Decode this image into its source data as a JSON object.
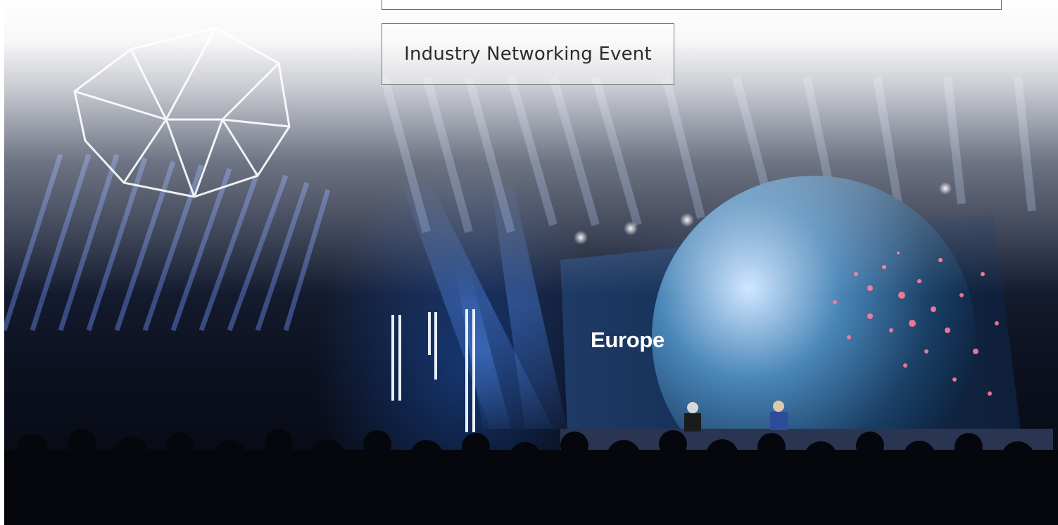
{
  "header_field": {
    "value": ""
  },
  "event_tag": {
    "label": "Industry Networking Event"
  },
  "hero_photo": {
    "screen_text": "Europe"
  },
  "colors": {
    "tag_border": "#7a7a7a",
    "tag_text": "#2b2b2b",
    "stage_light": "#3f7bff",
    "city_lights": "#ff6a8a"
  }
}
